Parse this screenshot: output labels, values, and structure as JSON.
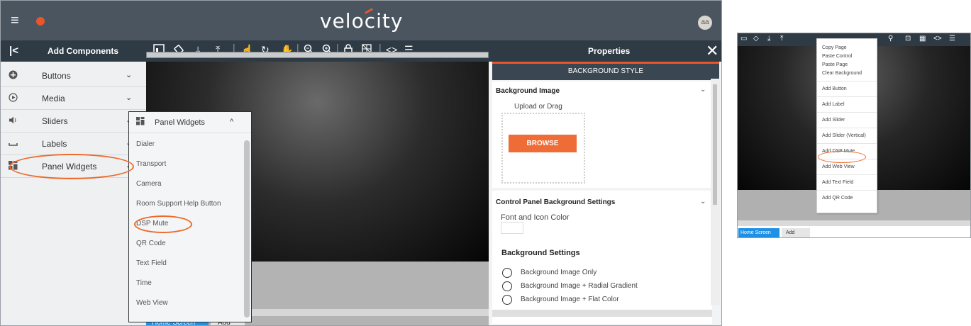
{
  "app": {
    "brand": "velocity",
    "avatar_initials": "aa"
  },
  "left_panel": {
    "title": "Add Components",
    "collapse_icon": "collapse-left-icon",
    "categories": [
      {
        "label": "Buttons",
        "icon": "plus-circle-icon"
      },
      {
        "label": "Media",
        "icon": "play-circle-icon"
      },
      {
        "label": "Sliders",
        "icon": "volume-icon"
      },
      {
        "label": "Labels",
        "icon": "label-icon"
      },
      {
        "label": "Panel Widgets",
        "icon": "widgets-icon"
      }
    ]
  },
  "toolbar": {
    "icons": [
      "screen-icon",
      "rotate-icon",
      "download-icon",
      "upload-icon",
      "pointer-icon",
      "refresh-icon",
      "hand-icon",
      "zoom-out-icon",
      "zoom-in-icon",
      "lock-icon",
      "grid-icon",
      "code-icon",
      "sliders-icon"
    ]
  },
  "widgets_popup": {
    "header": "Panel Widgets",
    "items": [
      "Dialer",
      "Transport",
      "Camera",
      "Room Support Help Button",
      "DSP Mute",
      "QR Code",
      "Text Field",
      "Time",
      "Web View"
    ]
  },
  "screens": {
    "home_tab": "Home Screen",
    "add_tab": "Add"
  },
  "properties": {
    "title": "Properties",
    "section": "BACKGROUND STYLE",
    "background_image": {
      "title": "Background Image",
      "upload_text": "Upload or Drag",
      "browse_label": "BROWSE"
    },
    "control_panel": {
      "title": "Control Panel Background Settings",
      "font_icon_color": "Font and Icon Color",
      "background_settings": "Background Settings",
      "options": [
        "Background Image Only",
        "Background Image + Radial Gradient",
        "Background Image + Flat Color"
      ]
    }
  },
  "context_menu": {
    "items": [
      "Copy Page",
      "Paste Control",
      "Paste Page",
      "Clear Background",
      "Add Button",
      "Add Label",
      "Add Slider",
      "Add Slider (Vertical)",
      "Add DSP Mute",
      "Add Web View",
      "Add Text Field",
      "Add QR Code"
    ],
    "side_home_tab": "Home Screen",
    "side_add_tab": "Add"
  },
  "colors": {
    "accent": "#e8562a",
    "topbar": "#4b5560",
    "panel_header": "#2e3b45",
    "tab_blue": "#1e90e6"
  }
}
